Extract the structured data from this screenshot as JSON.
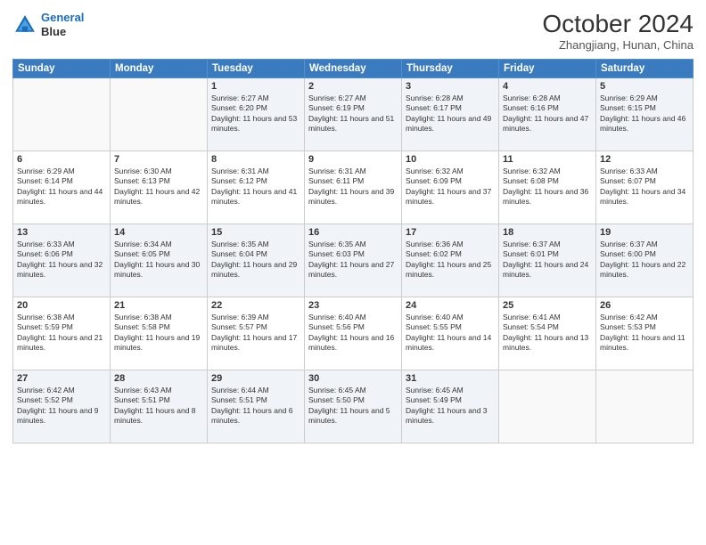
{
  "header": {
    "logo_line1": "General",
    "logo_line2": "Blue",
    "month": "October 2024",
    "location": "Zhangjiang, Hunan, China"
  },
  "days_of_week": [
    "Sunday",
    "Monday",
    "Tuesday",
    "Wednesday",
    "Thursday",
    "Friday",
    "Saturday"
  ],
  "weeks": [
    [
      {
        "day": "",
        "info": ""
      },
      {
        "day": "",
        "info": ""
      },
      {
        "day": "1",
        "info": "Sunrise: 6:27 AM\nSunset: 6:20 PM\nDaylight: 11 hours and 53 minutes."
      },
      {
        "day": "2",
        "info": "Sunrise: 6:27 AM\nSunset: 6:19 PM\nDaylight: 11 hours and 51 minutes."
      },
      {
        "day": "3",
        "info": "Sunrise: 6:28 AM\nSunset: 6:17 PM\nDaylight: 11 hours and 49 minutes."
      },
      {
        "day": "4",
        "info": "Sunrise: 6:28 AM\nSunset: 6:16 PM\nDaylight: 11 hours and 47 minutes."
      },
      {
        "day": "5",
        "info": "Sunrise: 6:29 AM\nSunset: 6:15 PM\nDaylight: 11 hours and 46 minutes."
      }
    ],
    [
      {
        "day": "6",
        "info": "Sunrise: 6:29 AM\nSunset: 6:14 PM\nDaylight: 11 hours and 44 minutes."
      },
      {
        "day": "7",
        "info": "Sunrise: 6:30 AM\nSunset: 6:13 PM\nDaylight: 11 hours and 42 minutes."
      },
      {
        "day": "8",
        "info": "Sunrise: 6:31 AM\nSunset: 6:12 PM\nDaylight: 11 hours and 41 minutes."
      },
      {
        "day": "9",
        "info": "Sunrise: 6:31 AM\nSunset: 6:11 PM\nDaylight: 11 hours and 39 minutes."
      },
      {
        "day": "10",
        "info": "Sunrise: 6:32 AM\nSunset: 6:09 PM\nDaylight: 11 hours and 37 minutes."
      },
      {
        "day": "11",
        "info": "Sunrise: 6:32 AM\nSunset: 6:08 PM\nDaylight: 11 hours and 36 minutes."
      },
      {
        "day": "12",
        "info": "Sunrise: 6:33 AM\nSunset: 6:07 PM\nDaylight: 11 hours and 34 minutes."
      }
    ],
    [
      {
        "day": "13",
        "info": "Sunrise: 6:33 AM\nSunset: 6:06 PM\nDaylight: 11 hours and 32 minutes."
      },
      {
        "day": "14",
        "info": "Sunrise: 6:34 AM\nSunset: 6:05 PM\nDaylight: 11 hours and 30 minutes."
      },
      {
        "day": "15",
        "info": "Sunrise: 6:35 AM\nSunset: 6:04 PM\nDaylight: 11 hours and 29 minutes."
      },
      {
        "day": "16",
        "info": "Sunrise: 6:35 AM\nSunset: 6:03 PM\nDaylight: 11 hours and 27 minutes."
      },
      {
        "day": "17",
        "info": "Sunrise: 6:36 AM\nSunset: 6:02 PM\nDaylight: 11 hours and 25 minutes."
      },
      {
        "day": "18",
        "info": "Sunrise: 6:37 AM\nSunset: 6:01 PM\nDaylight: 11 hours and 24 minutes."
      },
      {
        "day": "19",
        "info": "Sunrise: 6:37 AM\nSunset: 6:00 PM\nDaylight: 11 hours and 22 minutes."
      }
    ],
    [
      {
        "day": "20",
        "info": "Sunrise: 6:38 AM\nSunset: 5:59 PM\nDaylight: 11 hours and 21 minutes."
      },
      {
        "day": "21",
        "info": "Sunrise: 6:38 AM\nSunset: 5:58 PM\nDaylight: 11 hours and 19 minutes."
      },
      {
        "day": "22",
        "info": "Sunrise: 6:39 AM\nSunset: 5:57 PM\nDaylight: 11 hours and 17 minutes."
      },
      {
        "day": "23",
        "info": "Sunrise: 6:40 AM\nSunset: 5:56 PM\nDaylight: 11 hours and 16 minutes."
      },
      {
        "day": "24",
        "info": "Sunrise: 6:40 AM\nSunset: 5:55 PM\nDaylight: 11 hours and 14 minutes."
      },
      {
        "day": "25",
        "info": "Sunrise: 6:41 AM\nSunset: 5:54 PM\nDaylight: 11 hours and 13 minutes."
      },
      {
        "day": "26",
        "info": "Sunrise: 6:42 AM\nSunset: 5:53 PM\nDaylight: 11 hours and 11 minutes."
      }
    ],
    [
      {
        "day": "27",
        "info": "Sunrise: 6:42 AM\nSunset: 5:52 PM\nDaylight: 11 hours and 9 minutes."
      },
      {
        "day": "28",
        "info": "Sunrise: 6:43 AM\nSunset: 5:51 PM\nDaylight: 11 hours and 8 minutes."
      },
      {
        "day": "29",
        "info": "Sunrise: 6:44 AM\nSunset: 5:51 PM\nDaylight: 11 hours and 6 minutes."
      },
      {
        "day": "30",
        "info": "Sunrise: 6:45 AM\nSunset: 5:50 PM\nDaylight: 11 hours and 5 minutes."
      },
      {
        "day": "31",
        "info": "Sunrise: 6:45 AM\nSunset: 5:49 PM\nDaylight: 11 hours and 3 minutes."
      },
      {
        "day": "",
        "info": ""
      },
      {
        "day": "",
        "info": ""
      }
    ]
  ]
}
